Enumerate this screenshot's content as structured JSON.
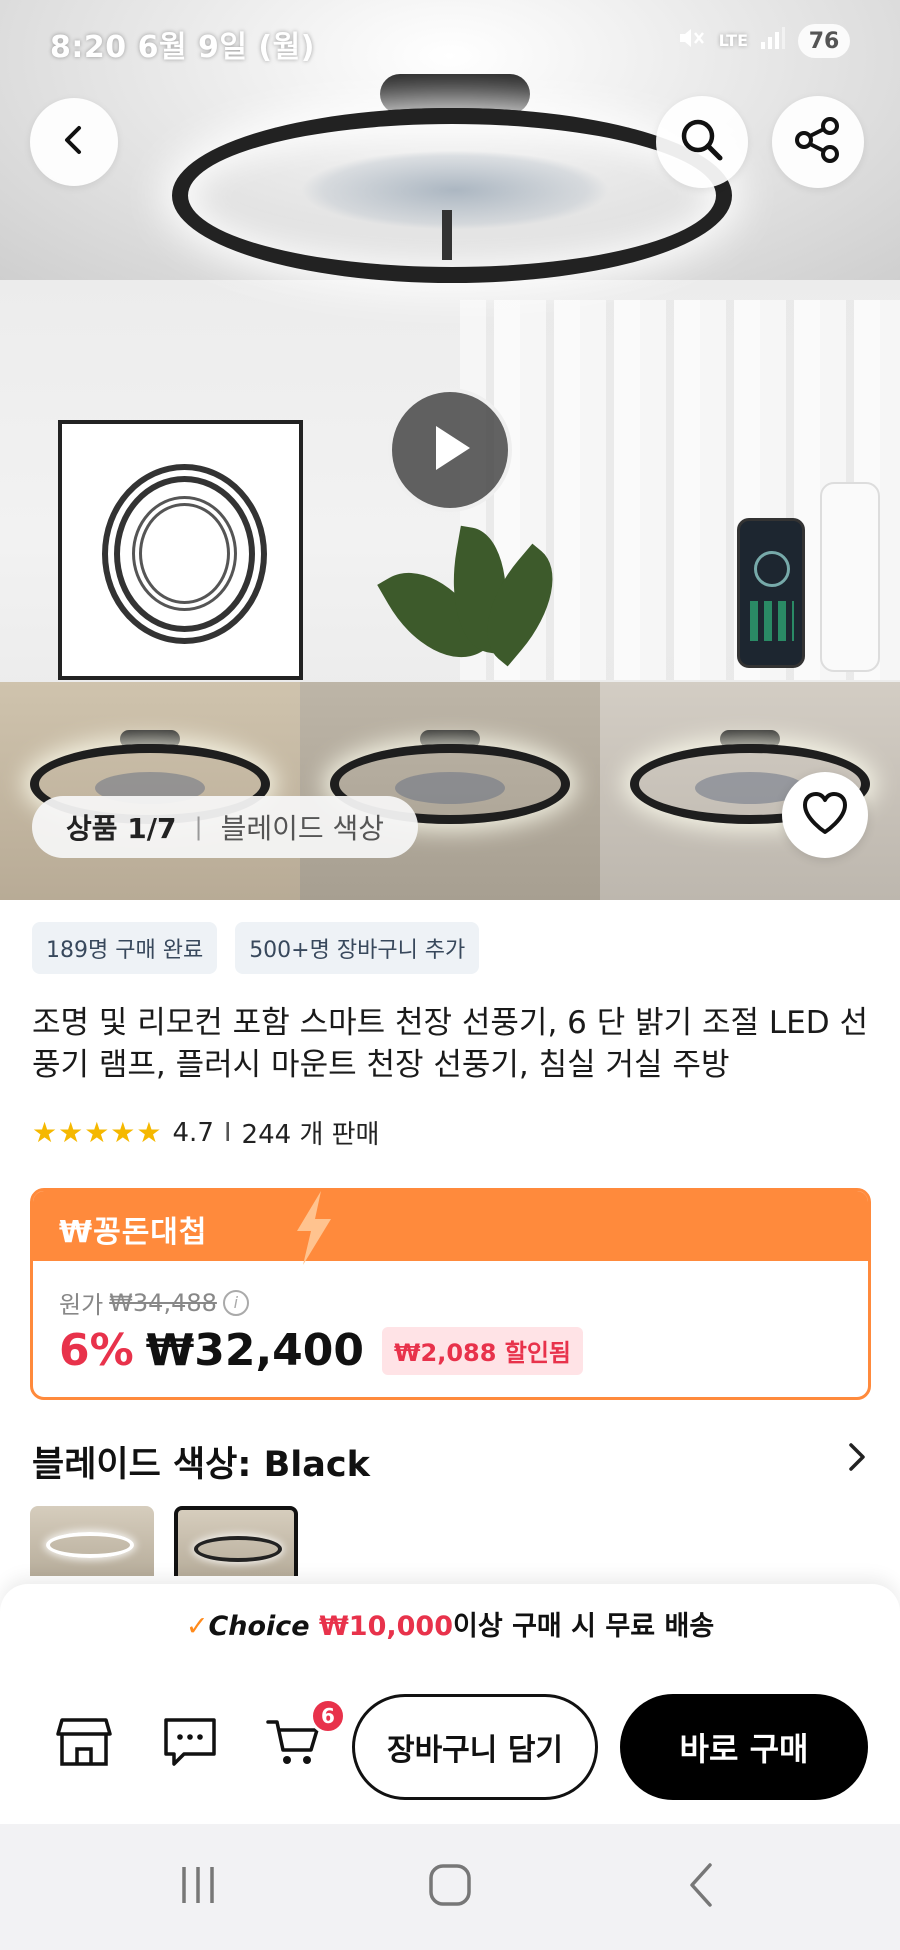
{
  "status_bar": {
    "time": "8:20  6월 9일 (월)",
    "network": "LTE",
    "battery": "76"
  },
  "gallery": {
    "page_count": "상품 1/7",
    "option_label": "블레이드 색상"
  },
  "badges": [
    {
      "label": "189명 구매 완료"
    },
    {
      "label": "500+명 장바구니 추가"
    }
  ],
  "product": {
    "title": "조명 및 리모컨 포함 스마트 천장 선풍기, 6 단 밝기 조절 LED 선풍기 램프, 플러시 마운트 천장 선풍기, 침실 거실 주방",
    "stars": "★★★★★",
    "rating": "4.7",
    "rating_divider": "I",
    "sold": "244 개 판매"
  },
  "deal": {
    "tag": "₩꽁돈대첩",
    "original_label": "원가",
    "original_price": "₩34,488",
    "discount": "6%",
    "price": "₩32,400",
    "saved": "₩2,088 할인됨"
  },
  "option": {
    "label": "블레이드 색상: Black"
  },
  "shipping": {
    "check": "✓",
    "choice": "Choice",
    "amount": "₩10,000",
    "text": "이상 구매 시 무료 배송"
  },
  "actions": {
    "cart_count": "6",
    "add_to_cart": "장바구니 담기",
    "buy_now": "바로 구매"
  },
  "icons": {
    "back": "chevron-left-icon",
    "search": "search-icon",
    "share": "share-icon",
    "play": "play-icon",
    "wishlist": "heart-icon",
    "store": "store-icon",
    "chat": "chat-icon",
    "cart": "cart-icon"
  },
  "colors": {
    "accent_orange": "#ff8a3c",
    "price_red": "#e8324b",
    "star_yellow": "#f5b800"
  }
}
